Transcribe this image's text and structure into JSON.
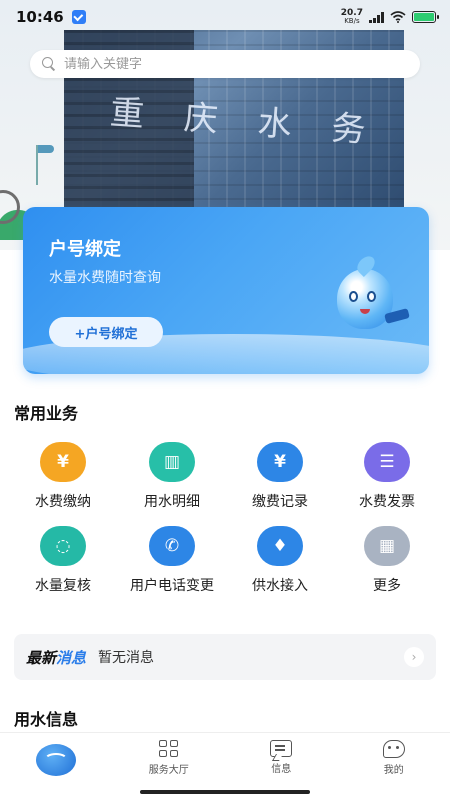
{
  "status_bar": {
    "time": "10:46",
    "net_speed_value": "20.7",
    "net_speed_unit": "KB/s",
    "battery_color": "#2ecc71"
  },
  "search": {
    "placeholder": "请输入关键字"
  },
  "hero_sign": "重庆水务",
  "bind_card": {
    "title": "户号绑定",
    "subtitle": "水量水费随时查询",
    "button_label": "+户号绑定"
  },
  "common_services": {
    "title": "常用业务",
    "items": [
      {
        "label": "水费缴纳",
        "icon": "water-fee-payment-icon",
        "color": "#f5a623"
      },
      {
        "label": "用水明细",
        "icon": "water-usage-detail-icon",
        "color": "#27bfa8"
      },
      {
        "label": "缴费记录",
        "icon": "payment-record-icon",
        "color": "#2d86e6"
      },
      {
        "label": "水费发票",
        "icon": "water-invoice-icon",
        "color": "#7a6ce8"
      },
      {
        "label": "水量复核",
        "icon": "water-volume-review-icon",
        "color": "#25b9a6"
      },
      {
        "label": "用户电话变更",
        "icon": "phone-change-icon",
        "color": "#2d86e6"
      },
      {
        "label": "供水接入",
        "icon": "water-supply-access-icon",
        "color": "#2d86e6"
      },
      {
        "label": "更多",
        "icon": "more-icon",
        "color": "#a9b3c2"
      }
    ]
  },
  "news": {
    "tag_part1": "最新",
    "tag_part2": "消息",
    "text": "暂无消息"
  },
  "water_info": {
    "title": "用水信息"
  },
  "tabbar": {
    "tabs": [
      {
        "label": "",
        "icon": "home-logo-icon"
      },
      {
        "label": "服务大厅",
        "icon": "service-hall-icon"
      },
      {
        "label": "信息",
        "icon": "message-icon"
      },
      {
        "label": "我的",
        "icon": "profile-icon"
      }
    ]
  }
}
